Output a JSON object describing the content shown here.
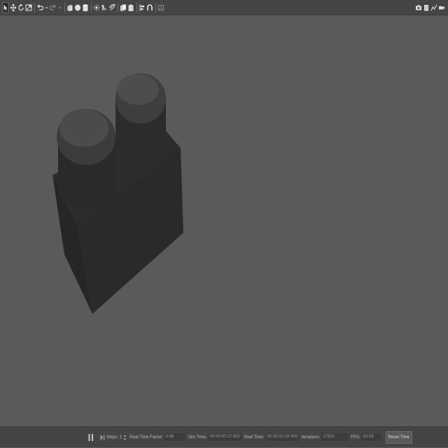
{
  "toolbar": {
    "left_tools": [
      "select-arrow-icon",
      "translate-icon",
      "rotate-icon",
      "scale-icon",
      "undo-icon",
      "undo-dropdown-icon",
      "redo-icon",
      "redo-dropdown-icon",
      "box-icon",
      "sphere-icon",
      "cylinder-icon",
      "point-light-icon",
      "spot-light-icon",
      "directional-light-icon",
      "copy-icon",
      "paste-icon",
      "align-icon",
      "snap-icon",
      "change-view-icon"
    ],
    "right_tools": [
      "screenshot-icon",
      "log-icon",
      "plot-icon",
      "video-record-icon"
    ]
  },
  "status": {
    "steps_label": "Steps:",
    "steps_value": "1",
    "rtf_label": "Real Time Factor:",
    "rtf_value": "0.98",
    "sim_time_label": "Sim Time:",
    "sim_time_value": "00 00:00:17.820",
    "real_time_label": "Real Time:",
    "real_time_value": "00 00:00:18.009",
    "iterations_label": "Iterations:",
    "iterations_value": "17820",
    "fps_label": "FPS:",
    "fps_value": "63.09",
    "reset_label": "Reset Time"
  },
  "colors": {
    "background": "#5a5a5a",
    "toolbar": "#454545",
    "model": "#2c2c2c"
  }
}
